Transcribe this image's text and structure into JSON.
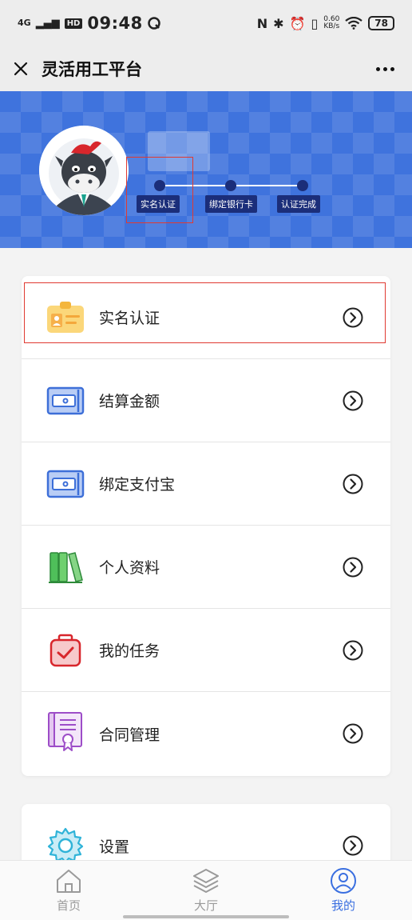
{
  "status_bar": {
    "network": "4G",
    "hd": "HD",
    "time": "09:48",
    "speed_value": "0.60",
    "speed_unit": "KB/s",
    "battery": "78"
  },
  "title_bar": {
    "title": "灵活用工平台"
  },
  "progress": {
    "steps": [
      {
        "label": "实名认证"
      },
      {
        "label": "绑定银行卡"
      },
      {
        "label": "认证完成"
      }
    ]
  },
  "menu": {
    "items": [
      {
        "label": "实名认证",
        "icon": "id-card-icon"
      },
      {
        "label": "结算金额",
        "icon": "wallet-icon"
      },
      {
        "label": "绑定支付宝",
        "icon": "wallet-icon"
      },
      {
        "label": "个人资料",
        "icon": "books-icon"
      },
      {
        "label": "我的任务",
        "icon": "task-bag-icon"
      },
      {
        "label": "合同管理",
        "icon": "contract-icon"
      }
    ],
    "settings": {
      "label": "设置",
      "icon": "gear-icon"
    }
  },
  "bottom_nav": {
    "items": [
      {
        "label": "首页"
      },
      {
        "label": "大厅"
      },
      {
        "label": "我的"
      }
    ]
  },
  "colors": {
    "header_blue": "#3f73dd",
    "step_navy": "#1b2e7a",
    "highlight_red": "#e03a32",
    "active_blue": "#3a6fe0"
  }
}
